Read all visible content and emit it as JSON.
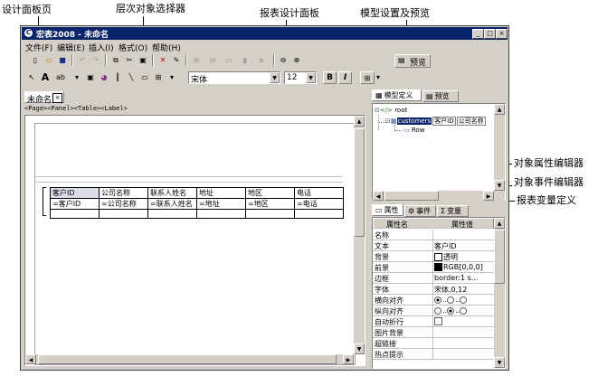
{
  "annotations": {
    "design_panel_tab": "设计面板页",
    "object_selector": "层次对象选择器",
    "report_design_panel": "报表设计面板",
    "model_settings_preview": "模型设置及预览",
    "object_property_editor": "对象属性编辑器",
    "object_event_editor": "对象事件编辑器",
    "report_variable_definition": "报表变量定义"
  },
  "window": {
    "title": "宏表2008 - 未命名",
    "controls": {
      "minimize": "_",
      "maximize": "□",
      "close": "×"
    }
  },
  "menu": [
    "文件(F)",
    "编辑(E)",
    "插入(I)",
    "格式(O)",
    "帮助(H)"
  ],
  "toolbar": {
    "preview_label": "预览",
    "font_name": "宋体",
    "font_size": "12",
    "bold": "B",
    "italic": "I",
    "text_tool": "A",
    "abc_tool": "ab"
  },
  "design": {
    "doc_tab": "未命名",
    "selector_path": "<Page><Panel><Table><Label>",
    "table": {
      "headers": [
        "客户ID",
        "公司名称",
        "联系人姓名",
        "地址",
        "地区",
        "电话"
      ],
      "bindings": [
        "=客户ID",
        "=公司名称",
        "=联系人姓名",
        "=地址",
        "=地区",
        "=电话"
      ]
    }
  },
  "model_panel": {
    "tabs": [
      "模型定义",
      "预览"
    ],
    "tree": {
      "root": "root",
      "customers": "customers",
      "cols": [
        "客户ID",
        "公司名称"
      ],
      "row": "Row"
    }
  },
  "property_panel": {
    "tabs": [
      "属性",
      "事件",
      "变量"
    ],
    "headers": [
      "属性名",
      "属性值"
    ],
    "rows": [
      {
        "name": "名称",
        "value": ""
      },
      {
        "name": "文本",
        "value": "客户ID"
      },
      {
        "name": "背景",
        "value": "透明"
      },
      {
        "name": "前景",
        "value": "RGB[0,0,0]"
      },
      {
        "name": "边框",
        "value": "border:1 s..."
      },
      {
        "name": "字体",
        "value": "宋体,0,12"
      },
      {
        "name": "横向对齐",
        "value": ""
      },
      {
        "name": "纵向对齐",
        "value": ""
      },
      {
        "name": "自动折行",
        "value": ""
      },
      {
        "name": "图片背景",
        "value": ""
      },
      {
        "name": "超链接",
        "value": ""
      },
      {
        "name": "热点提示",
        "value": ""
      }
    ]
  }
}
